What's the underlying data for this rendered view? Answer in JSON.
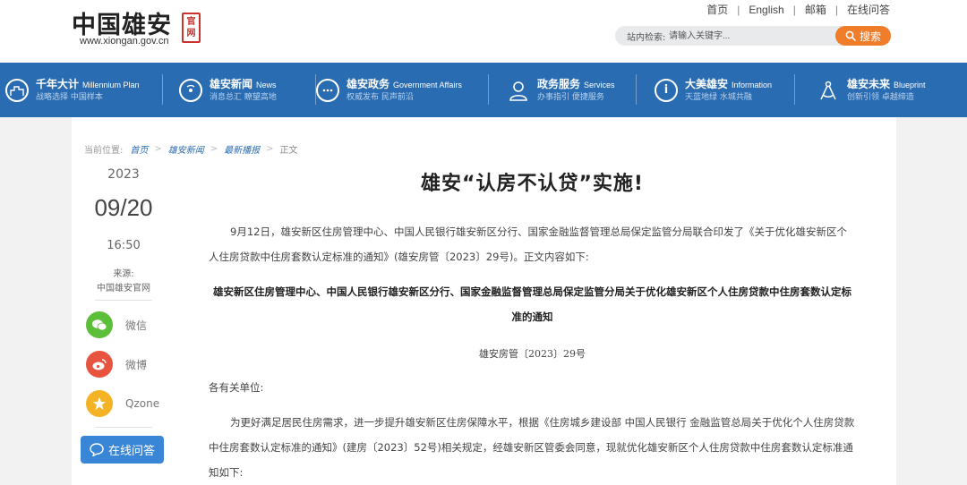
{
  "header": {
    "logo_title": "中国雄安",
    "logo_seal": "官网",
    "logo_url": "www.xiongan.gov.cn",
    "links": [
      "首页",
      "English",
      "邮箱",
      "在线问答"
    ],
    "search_label": "站内检索:",
    "search_placeholder": "请输入关键字...",
    "search_button": "搜索"
  },
  "nav": [
    {
      "zh": "千年大计",
      "en": "Millennium Plan",
      "sub": "战略选择  中国样本",
      "icon": "city-icon"
    },
    {
      "zh": "雄安新闻",
      "en": "News",
      "sub": "消息总汇  瞭望高地",
      "icon": "news-icon"
    },
    {
      "zh": "雄安政务",
      "en": "Government Affairs",
      "sub": "权威发布  民声前沿",
      "icon": "chat-icon"
    },
    {
      "zh": "政务服务",
      "en": "Services",
      "sub": "办事指引  便捷服务",
      "icon": "user-icon"
    },
    {
      "zh": "大美雄安",
      "en": "Information",
      "sub": "天蓝地绿  水城共融",
      "icon": "info-icon"
    },
    {
      "zh": "雄安未来",
      "en": "Blueprint",
      "sub": "创新引领  卓越缔造",
      "icon": "compass-icon"
    }
  ],
  "breadcrumb": {
    "label": "当前位置:",
    "items": [
      "首页",
      "雄安新闻",
      "最新播报"
    ],
    "current": "正文"
  },
  "meta": {
    "year": "2023",
    "date": "09/20",
    "time": "16:50",
    "source_label": "来源:",
    "source": "中国雄安官网"
  },
  "share": [
    {
      "label": "微信",
      "icon": "wechat-icon",
      "color": "#5cbf3a"
    },
    {
      "label": "微博",
      "icon": "weibo-icon",
      "color": "#e8533f"
    },
    {
      "label": "Qzone",
      "icon": "qzone-icon",
      "color": "#f3b324"
    }
  ],
  "ask_button": "在线问答",
  "article": {
    "title": "雄安“认房不认贷”实施!",
    "p1": "9月12日，雄安新区住房管理中心、中国人民银行雄安新区分行、国家金融监督管理总局保定监管分局联合印发了《关于优化雄安新区个人住房贷款中住房套数认定标准的通知》(雄安房管〔2023〕29号)。正文内容如下:",
    "doc_title": "雄安新区住房管理中心、中国人民银行雄安新区分行、国家金融监督管理总局保定监管分局关于优化雄安新区个人住房贷款中住房套数认定标准的通知",
    "doc_no": "雄安房管〔2023〕29号",
    "salutation": "各有关单位:",
    "p2": "为更好满足居民住房需求，进一步提升雄安新区住房保障水平，根据《住房城乡建设部 中国人民银行 金融监管总局关于优化个人住房贷款中住房套数认定标准的通知》(建房〔2023〕52号)相关规定，经雄安新区管委会同意，现就优化雄安新区个人住房贷款中住房套数认定标准通知如下:"
  },
  "colors": {
    "nav_bg": "#2a6cb1",
    "search_btn": "#f07d29",
    "ask_btn": "#3a86d6",
    "seal": "#c8332c"
  }
}
